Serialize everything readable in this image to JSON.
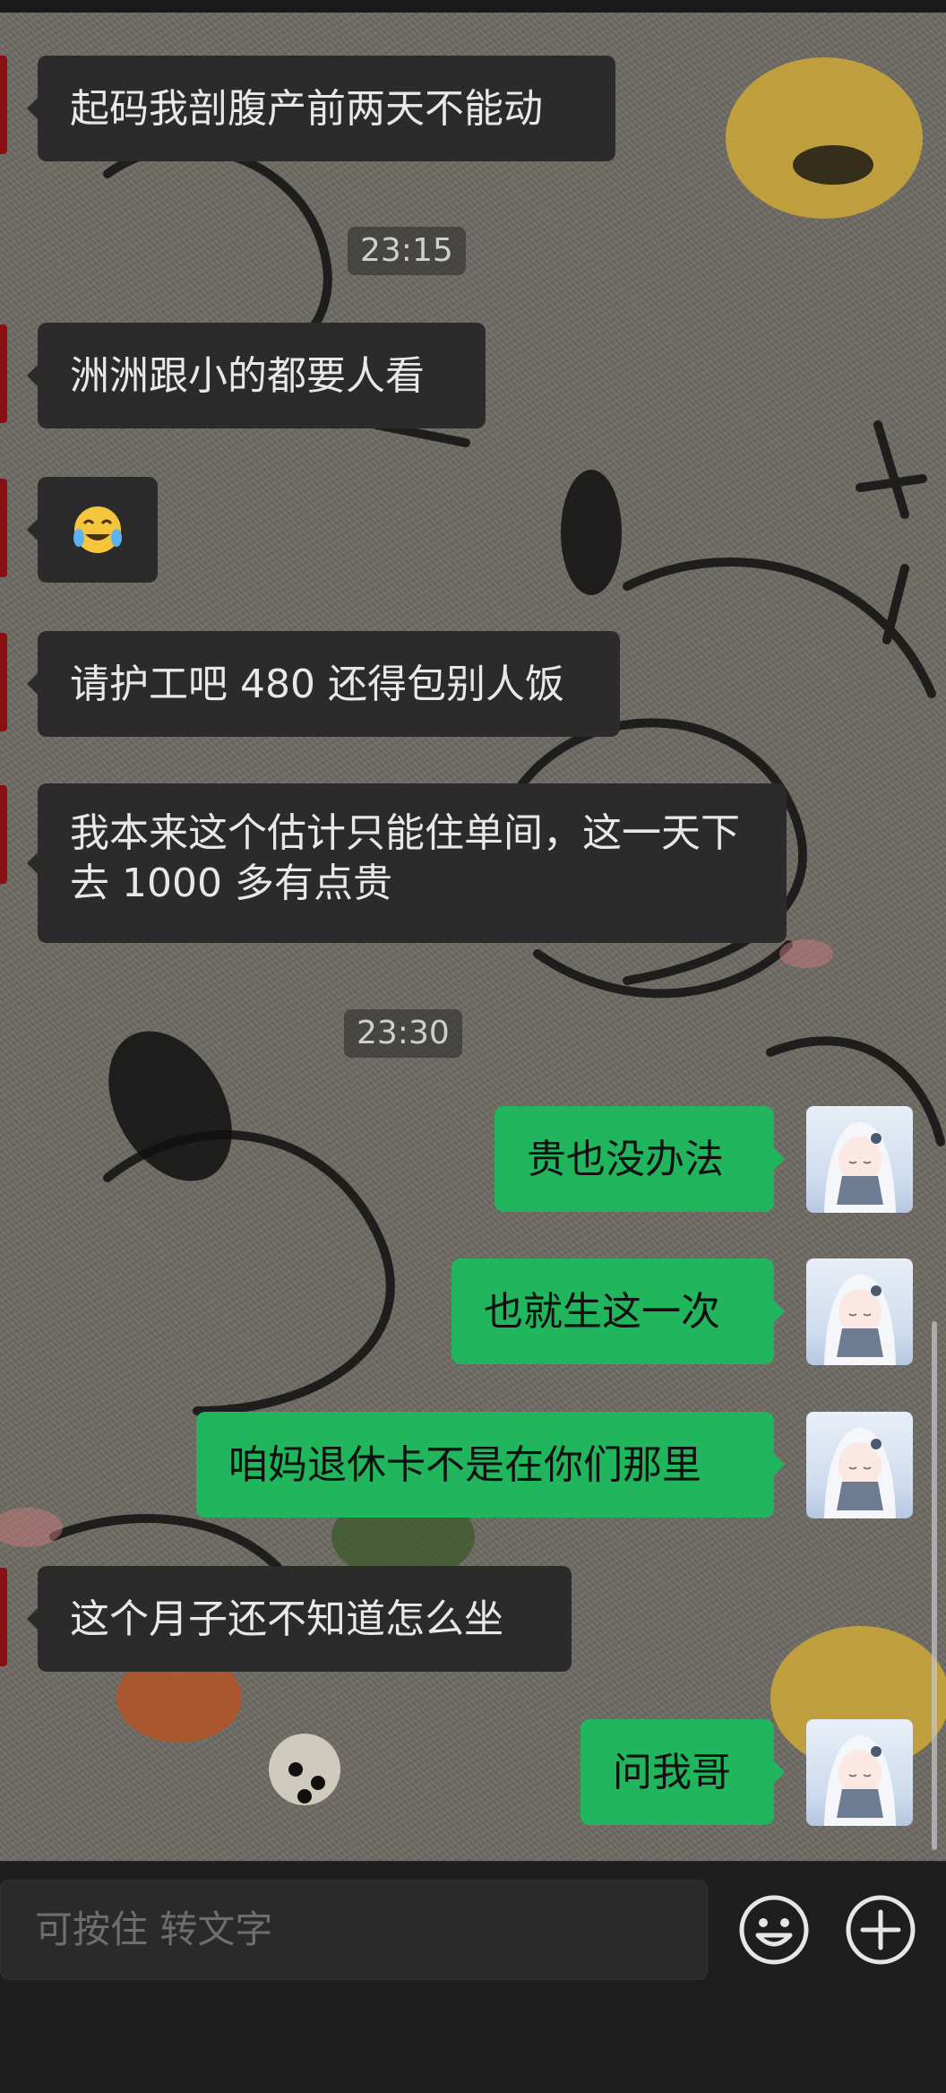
{
  "chat": {
    "messages": [
      {
        "id": "m1",
        "text": "起码我剖腹产前两天不能动"
      },
      {
        "id": "m2",
        "text": "洲洲跟小的都要人看"
      },
      {
        "id": "m3",
        "emoji_name": "crying-laughing-emoji"
      },
      {
        "id": "m4",
        "text": "请护工吧 480 还得包别人饭"
      },
      {
        "id": "m5",
        "text": "我本来这个估计只能住单间，这一天下去 1000 多有点贵"
      },
      {
        "id": "m6",
        "text": "贵也没办法"
      },
      {
        "id": "m7",
        "text": "也就生这一次"
      },
      {
        "id": "m8",
        "text": "咱妈退休卡不是在你们那里"
      },
      {
        "id": "m9",
        "text": "这个月子还不知道怎么坐"
      },
      {
        "id": "m10",
        "text": "问我哥"
      }
    ],
    "timestamps": [
      "23:15",
      "23:30"
    ]
  },
  "input_bar": {
    "placeholder": "可按住 转文字",
    "emoji_button_icon": "smiley-icon",
    "more_button_icon": "plus-circle-icon"
  },
  "colors": {
    "incoming_bubble": "#2b2b2b",
    "outgoing_bubble": "#21b55e",
    "background": "#1e1e1e"
  }
}
